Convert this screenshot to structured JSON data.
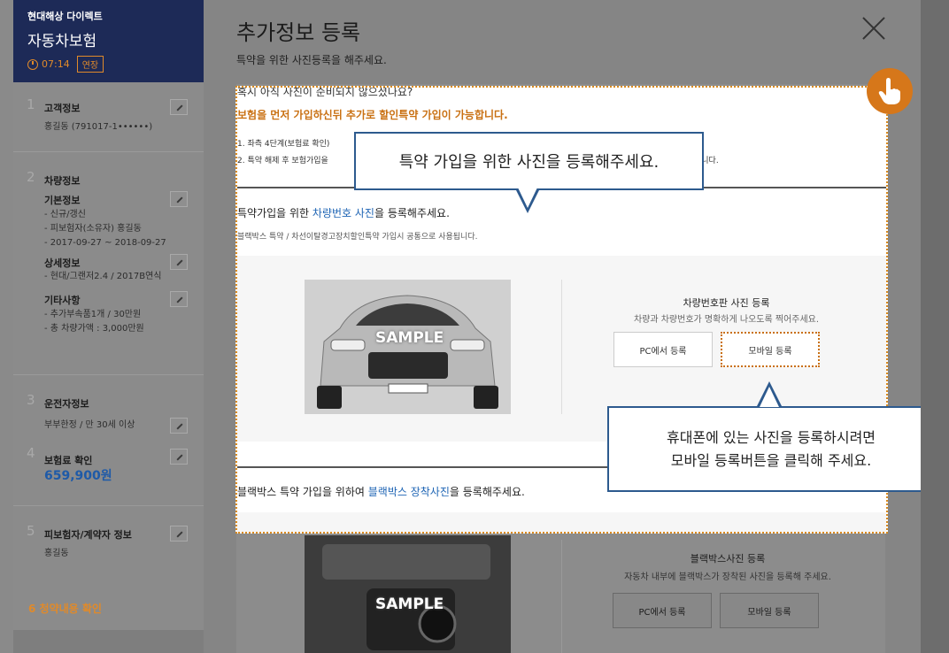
{
  "sidebar": {
    "brand": "현대해상 다이렉트",
    "product": "자동차보험",
    "timer": "07:14",
    "extend_label": "연장",
    "steps": {
      "s1": {
        "num": "1",
        "title": "고객정보",
        "sub": "홍길동 (791017-1••••••)"
      },
      "s2": {
        "num": "2",
        "title": "차량정보",
        "basic_title": "기본정보",
        "basic_lines": [
          "- 신규/갱신",
          "- 피보험자(소유자) 홍길동",
          "- 2017-09-27 ~ 2018-09-27"
        ],
        "detail_title": "상세정보",
        "detail_line": "- 현대/그랜저2.4 / 2017B연식",
        "etc_title": "기타사항",
        "etc_lines": [
          "- 추가부속품1개 / 30만원",
          "- 총 차량가액 : 3,000만원"
        ]
      },
      "s3": {
        "num": "3",
        "title": "운전자정보",
        "sub": "부부한정 / 만 30세 이상"
      },
      "s4": {
        "num": "4",
        "title": "보험료 확인",
        "amount": "659,900원"
      },
      "s5": {
        "num": "5",
        "title": "피보험자/계약자 정보",
        "sub": "홍길동"
      },
      "s6": {
        "label": "6 청약내용 확인"
      }
    }
  },
  "modal": {
    "title": "추가정보 등록",
    "subtitle": "특약을 위한 사진등록을 해주세요.",
    "question": "혹시 아직 사진이 준비되지 않으셨나요?",
    "orange_note": "보험을 먼저 가입하신뒤 추가로 할인특약 가입이 가능합니다.",
    "note1": "1. 좌측 4단계(보험료 확인)",
    "note2": "2. 특약 해제 후 보험가입을",
    "note2_tail": "입이 가능합니다.",
    "section1": {
      "title_pre": "특약가입을 위한 ",
      "title_link": "차량번호 사진",
      "title_post": "을 등록해주세요.",
      "desc": "블랙박스 특약 / 차선이탈경고장치할인특약 가입시 공통으로 사용됩니다.",
      "sample": "SAMPLE",
      "reg_title": "차량번호판 사진 등록",
      "reg_desc": "차량과 차량번호가 명확하게 나오도록 찍어주세요.",
      "pc_button": "PC에서 등록",
      "mobile_button": "모바일 등록"
    },
    "section2": {
      "title_pre": "블랙박스 특약 가입을 위하여 ",
      "title_link": "블랙박스 장착사진",
      "title_post": "을 등록해주세요.",
      "sample": "SAMPLE",
      "reg_title": "블랙박스사진 등록",
      "reg_desc": "자동차 내부에 블랙박스가 장착된 사진을 등록해 주세요.",
      "pc_button": "PC에서 등록",
      "mobile_button": "모바일 등록"
    }
  },
  "tooltips": {
    "tip1": "특약 가입을 위한 사진을 등록해주세요.",
    "tip2_line1": "휴대폰에 있는 사진을 등록하시려면",
    "tip2_line2": "모바일 등록버튼을 클릭해 주세요."
  },
  "colors": {
    "navy": "#1d2a57",
    "orange": "#d6771a",
    "link_blue": "#1e64b4",
    "tooltip_border": "#2d5a8e"
  }
}
